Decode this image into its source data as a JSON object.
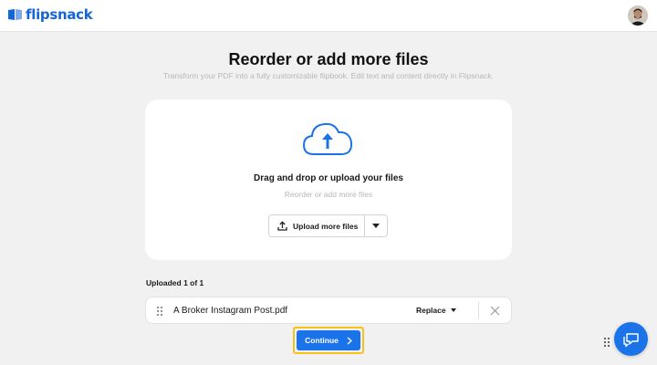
{
  "header": {
    "brand": "flipsnack",
    "logo_icon": "flipsnack-logo-icon",
    "avatar_icon": "user-avatar"
  },
  "main": {
    "title": "Reorder or add more files",
    "subtitle": "Transform your PDF into a fully customizable flipbook. Edit text and content directly in Flipsnack."
  },
  "upload_card": {
    "cloud_icon": "cloud-upload-icon",
    "drop_title": "Drag and drop or upload your files",
    "drop_subtitle": "Reorder or add more files",
    "upload_button_label": "Upload more files",
    "upload_icon": "upload-icon",
    "dropdown_icon": "caret-down-icon"
  },
  "files": {
    "uploaded_label": "Uploaded 1 of 1",
    "items": [
      {
        "name": "A Broker Instagram Post.pdf",
        "replace_label": "Replace"
      }
    ]
  },
  "actions": {
    "continue_label": "Continue"
  },
  "colors": {
    "accent": "#1a73e8",
    "brand": "#1565d8",
    "highlight": "#f5c21b",
    "background": "#f1f1f1"
  }
}
